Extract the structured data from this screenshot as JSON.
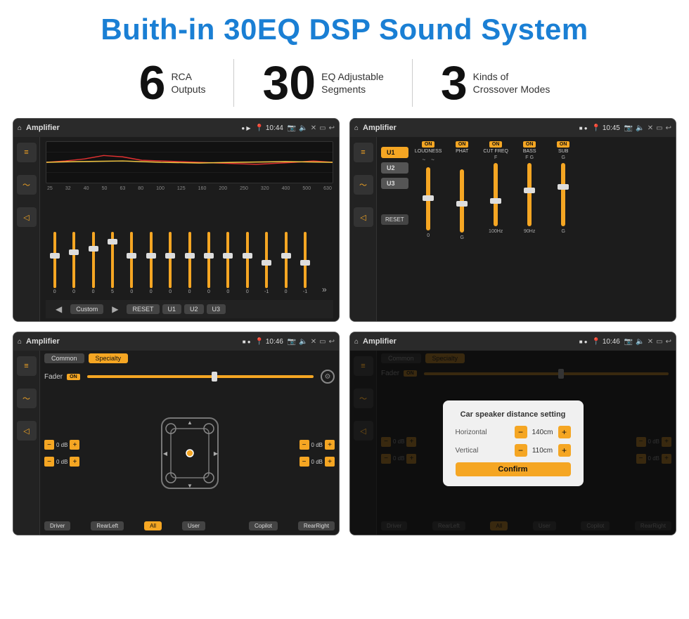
{
  "page": {
    "title": "Buith-in 30EQ DSP Sound System",
    "bg": "#ffffff"
  },
  "stats": [
    {
      "number": "6",
      "label_line1": "RCA",
      "label_line2": "Outputs"
    },
    {
      "number": "30",
      "label_line1": "EQ Adjustable",
      "label_line2": "Segments"
    },
    {
      "number": "3",
      "label_line1": "Kinds of",
      "label_line2": "Crossover Modes"
    }
  ],
  "screens": [
    {
      "id": "screen1",
      "topbar": {
        "title": "Amplifier",
        "time": "10:44"
      },
      "eq_freqs": [
        "25",
        "32",
        "40",
        "50",
        "63",
        "80",
        "100",
        "125",
        "160",
        "200",
        "250",
        "320",
        "400",
        "500",
        "630"
      ],
      "eq_values": [
        "0",
        "0",
        "0",
        "5",
        "0",
        "0",
        "0",
        "0",
        "0",
        "0",
        "0",
        "-1",
        "0",
        "-1"
      ],
      "buttons": [
        "Custom",
        "RESET",
        "U1",
        "U2",
        "U3"
      ]
    },
    {
      "id": "screen2",
      "topbar": {
        "title": "Amplifier",
        "time": "10:45"
      },
      "presets": [
        "U1",
        "U2",
        "U3"
      ],
      "controls": [
        {
          "name": "LOUDNESS",
          "on": true
        },
        {
          "name": "PHAT",
          "on": true
        },
        {
          "name": "CUT FREQ",
          "on": true
        },
        {
          "name": "BASS",
          "on": true
        },
        {
          "name": "SUB",
          "on": true
        }
      ]
    },
    {
      "id": "screen3",
      "topbar": {
        "title": "Amplifier",
        "time": "10:46"
      },
      "tabs": [
        "Common",
        "Specialty"
      ],
      "fader_label": "Fader",
      "fader_on": "ON",
      "db_values": [
        "0 dB",
        "0 dB",
        "0 dB",
        "0 dB"
      ],
      "bottom_buttons": [
        "Driver",
        "RearLeft",
        "All",
        "User",
        "Copilot",
        "RearRight"
      ]
    },
    {
      "id": "screen4",
      "topbar": {
        "title": "Amplifier",
        "time": "10:46"
      },
      "tabs": [
        "Common",
        "Specialty"
      ],
      "dialog": {
        "title": "Car speaker distance setting",
        "rows": [
          {
            "label": "Horizontal",
            "value": "140cm"
          },
          {
            "label": "Vertical",
            "value": "110cm"
          }
        ],
        "confirm_label": "Confirm"
      },
      "db_values": [
        "0 dB",
        "0 dB"
      ],
      "bottom_buttons": [
        "Driver",
        "RearLeft",
        "All",
        "User",
        "Copilot",
        "RearRight"
      ]
    }
  ]
}
